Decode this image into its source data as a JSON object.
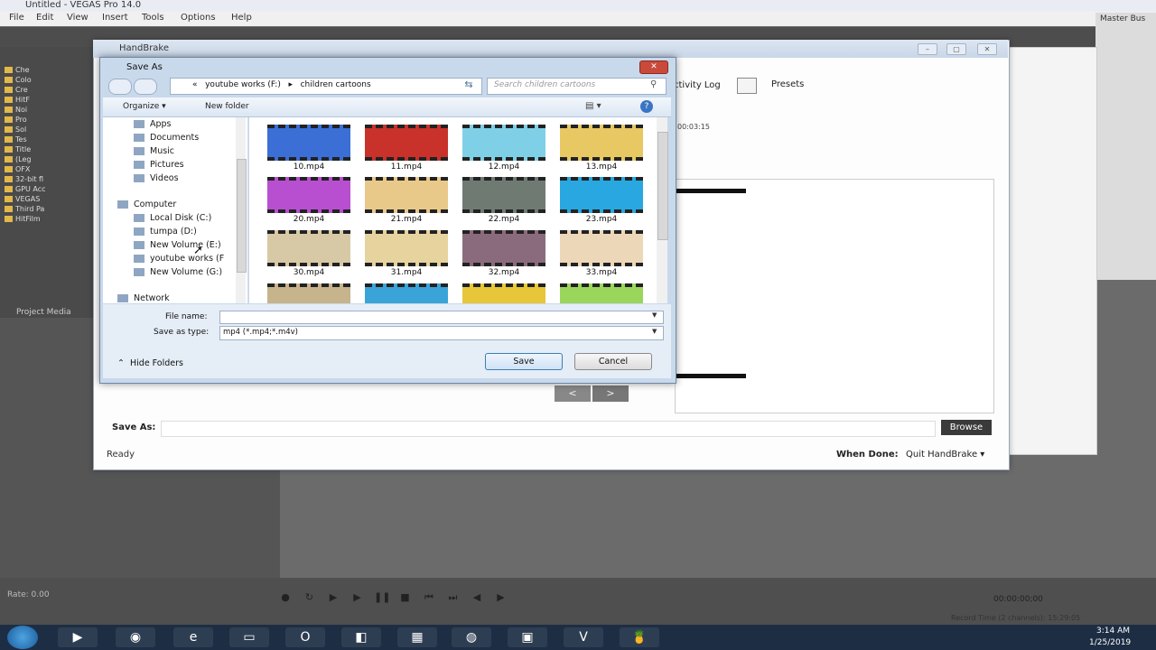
{
  "vegas": {
    "title": "Untitled - VEGAS Pro 14.0",
    "menu": [
      "File",
      "Edit",
      "View",
      "Insert",
      "Tools",
      "Options",
      "Help"
    ],
    "tree_items": [
      "Che",
      "Colo",
      "Cre",
      "HitF",
      "Noi",
      "Pro",
      "Sol",
      "Tes",
      "Title",
      "(Leg",
      "OFX",
      "32-bit fl",
      "GPU Acc",
      "VEGAS",
      "Third Pa",
      "HitFilm"
    ],
    "project_media_tab": "Project Media",
    "rate": "Rate: 0.00",
    "timecode": "00:00:00;00",
    "record_time": "Record Time (2 channels): 15:29:05",
    "master_bus": "Master Bus"
  },
  "handbrake": {
    "title": "HandBrake",
    "activity_log": "ctivity Log",
    "presets": "Presets",
    "duration": "00:03:15",
    "prev": "<",
    "next": ">",
    "save_as_label": "Save As:",
    "save_as_value": "",
    "browse": "Browse",
    "status": "Ready",
    "when_done_label": "When Done:",
    "when_done_value": "Quit HandBrake ▾"
  },
  "dialog": {
    "title": "Save As",
    "close": "✕",
    "breadcrumb": [
      "«",
      "youtube works (F:)",
      "▸",
      "children cartoons"
    ],
    "search_placeholder": "Search children cartoons",
    "organize": "Organize ▾",
    "new_folder": "New folder",
    "help": "?",
    "nav_items": [
      "Apps",
      "Documents",
      "Music",
      "Pictures",
      "Videos",
      "Computer",
      "Local Disk (C:)",
      "tumpa (D:)",
      "New Volume (E:)",
      "youtube works (F",
      "New Volume (G:)",
      "Network"
    ],
    "files": [
      {
        "name": "10.mp4",
        "color": "#3b6fd6"
      },
      {
        "name": "11.mp4",
        "color": "#c8322b"
      },
      {
        "name": "12.mp4",
        "color": "#7fd0e6"
      },
      {
        "name": "13.mp4",
        "color": "#e7c862"
      },
      {
        "name": "20.mp4",
        "color": "#b84fd0"
      },
      {
        "name": "21.mp4",
        "color": "#e9c98a"
      },
      {
        "name": "22.mp4",
        "color": "#6f7a73"
      },
      {
        "name": "23.mp4",
        "color": "#29a7e0"
      },
      {
        "name": "30.mp4",
        "color": "#d8c9a6"
      },
      {
        "name": "31.mp4",
        "color": "#e6d39e"
      },
      {
        "name": "32.mp4",
        "color": "#8a6b7d"
      },
      {
        "name": "33.mp4",
        "color": "#ecd7b9"
      },
      {
        "name": "",
        "color": "#c7b38c"
      },
      {
        "name": "",
        "color": "#3aa4d8"
      },
      {
        "name": "",
        "color": "#e8c63a"
      },
      {
        "name": "",
        "color": "#9ad65c"
      }
    ],
    "file_name_label": "File name:",
    "file_name_value": "",
    "save_type_label": "Save as type:",
    "save_type_value": "mp4 (*.mp4;*.m4v)",
    "hide_folders": "Hide Folders",
    "save": "Save",
    "cancel": "Cancel"
  },
  "taskbar": {
    "time": "3:14 AM",
    "date": "1/25/2019"
  }
}
